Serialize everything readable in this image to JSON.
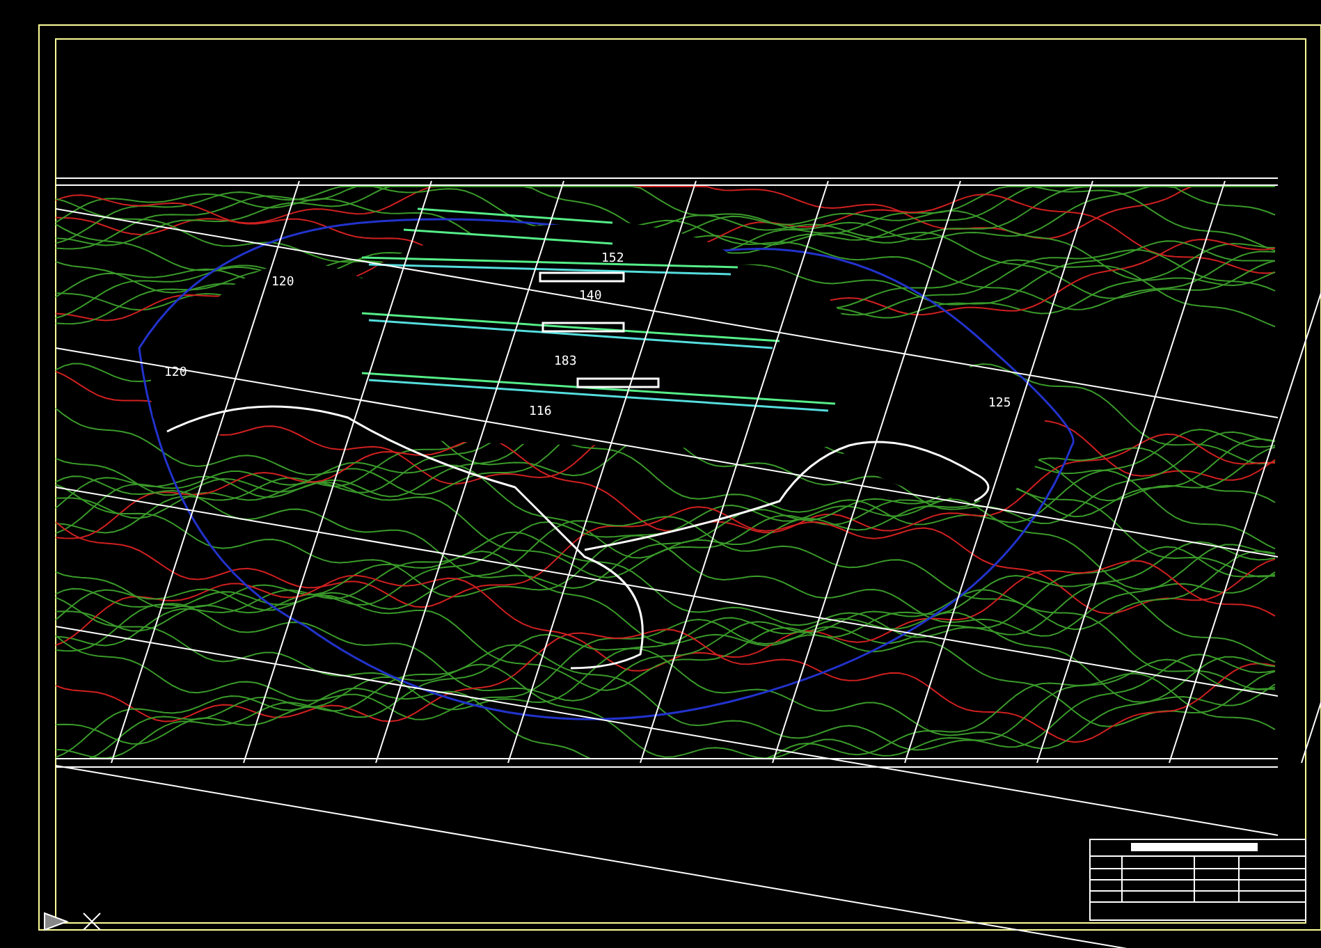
{
  "map_labels": [
    {
      "text": "120"
    },
    {
      "text": "120"
    },
    {
      "text": "152"
    },
    {
      "text": "140"
    },
    {
      "text": "183"
    },
    {
      "text": "116"
    },
    {
      "text": "125"
    }
  ]
}
